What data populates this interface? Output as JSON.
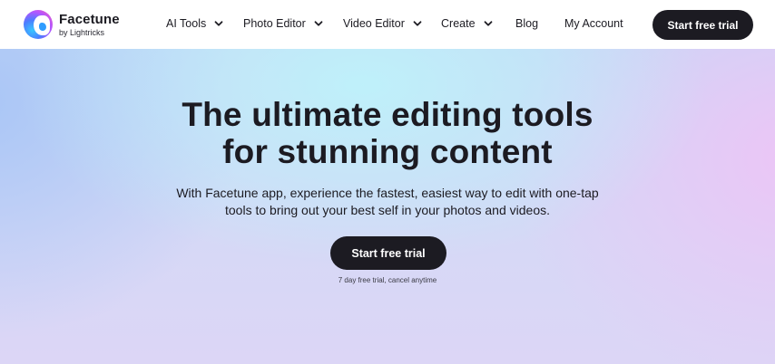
{
  "header": {
    "logo_name": "Facetune",
    "logo_sub": "by Lightricks",
    "nav": [
      {
        "label": "AI Tools",
        "dropdown": true
      },
      {
        "label": "Photo Editor",
        "dropdown": true
      },
      {
        "label": "Video Editor",
        "dropdown": true
      },
      {
        "label": "Create",
        "dropdown": true
      },
      {
        "label": "Blog",
        "dropdown": false
      },
      {
        "label": "My Account",
        "dropdown": false
      }
    ],
    "cta_label": "Start free trial"
  },
  "hero": {
    "title_line1": "The ultimate editing tools",
    "title_line2": "for stunning content",
    "description_line1": "With Facetune app, experience the fastest, easiest way to edit with one-tap",
    "description_line2": "tools to bring out your best self in your photos and videos.",
    "cta_label": "Start free trial",
    "note": "7 day free trial, cancel anytime"
  },
  "colors": {
    "text": "#1c1b22",
    "button_bg": "#1c1b22",
    "button_text": "#ffffff"
  },
  "icons": {
    "logo": "facetune-logo-icon",
    "nav_dropdown": "chevron-down-icon"
  }
}
